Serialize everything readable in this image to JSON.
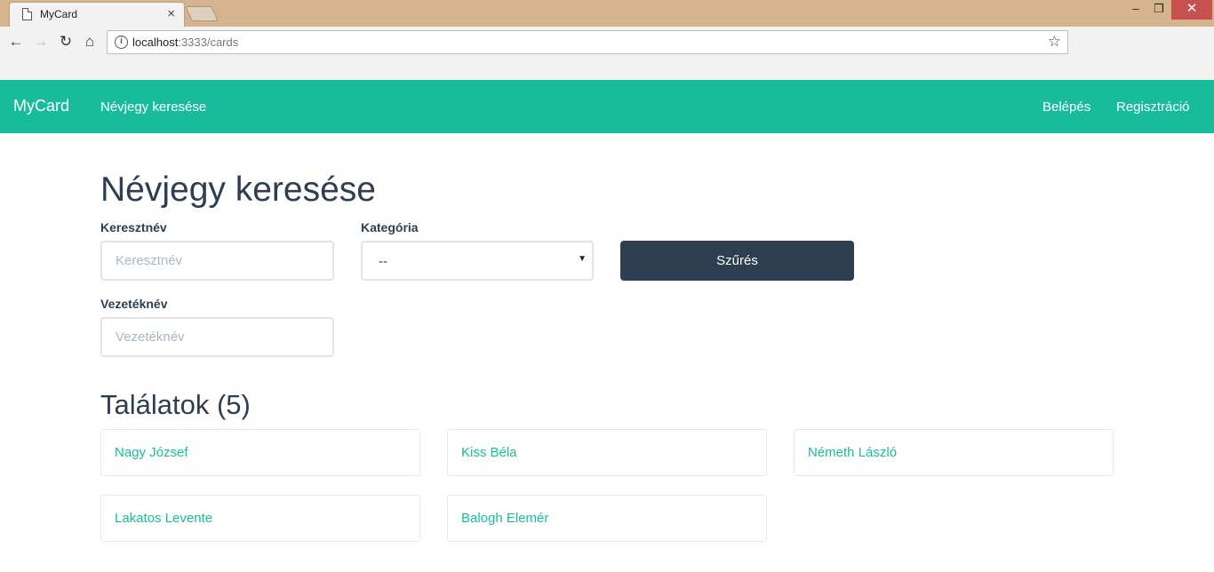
{
  "browser": {
    "tab_title": "MyCard",
    "tab_close": "×",
    "url_host": "localhost",
    "url_rest": ":3333/cards",
    "win_minimize": "–",
    "win_maximize": "❐",
    "win_close": "✕",
    "back_icon": "←",
    "forward_icon": "→",
    "reload_icon": "↻",
    "home_icon": "⌂",
    "info_icon": "i",
    "star_icon": "☆"
  },
  "navbar": {
    "brand": "MyCard",
    "search_link": "Névjegy keresése",
    "login": "Belépés",
    "register": "Regisztráció",
    "color": "#18bc9c"
  },
  "page": {
    "title": "Névjegy keresése",
    "first_name_label": "Keresztnév",
    "first_name_placeholder": "Keresztnév",
    "first_name_value": "",
    "category_label": "Kategória",
    "category_selected": "--",
    "last_name_label": "Vezetéknév",
    "last_name_placeholder": "Vezetéknév",
    "last_name_value": "",
    "filter_button": "Szűrés",
    "results_title": "Találatok (5)",
    "results": [
      "Nagy József",
      "Kiss Béla",
      "Németh László",
      "Lakatos Levente",
      "Balogh Elemér"
    ]
  },
  "colors": {
    "accent": "#18bc9c",
    "primary_dark": "#2c3e50"
  }
}
